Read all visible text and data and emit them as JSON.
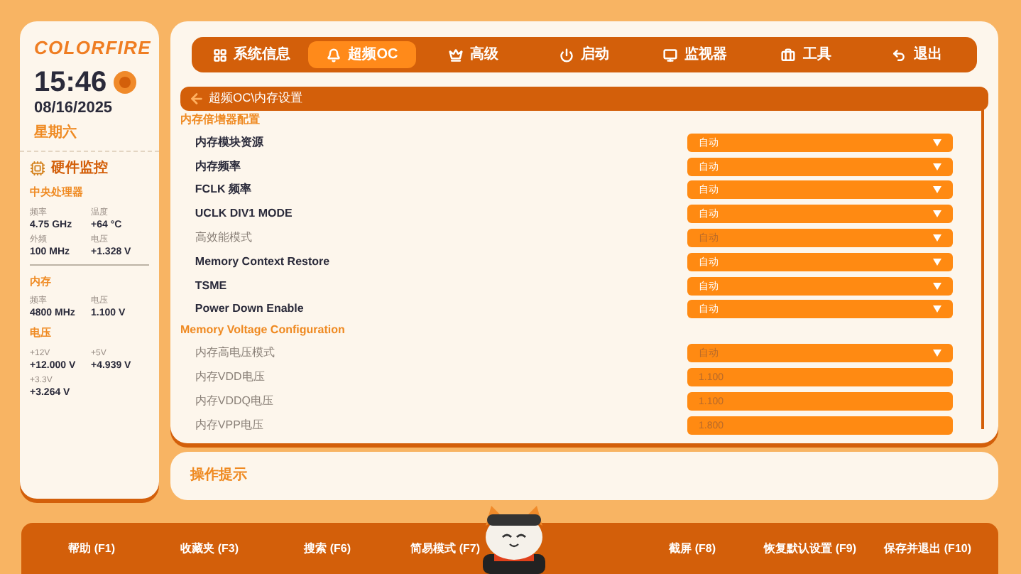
{
  "sidebar": {
    "brand": "COLORFIRE",
    "time": "15:46",
    "date": "08/16/2025",
    "weekday": "星期六",
    "monitor_title": "硬件监控",
    "groups": [
      {
        "title": "中央处理器",
        "stats": [
          {
            "label": "频率",
            "value": "4.75 GHz"
          },
          {
            "label": "温度",
            "value": "+64 °C"
          },
          {
            "label": "外频",
            "value": "100 MHz"
          },
          {
            "label": "电压",
            "value": "+1.328 V"
          }
        ]
      },
      {
        "title": "内存",
        "stats": [
          {
            "label": "频率",
            "value": "4800 MHz"
          },
          {
            "label": "电压",
            "value": "1.100 V"
          }
        ]
      },
      {
        "title": "电压",
        "stats": [
          {
            "label": "+12V",
            "value": "+12.000 V"
          },
          {
            "label": "+5V",
            "value": "+4.939 V"
          },
          {
            "label": "+3.3V",
            "value": "+3.264 V"
          }
        ]
      }
    ]
  },
  "tabs": [
    {
      "label": "系统信息",
      "selected": false
    },
    {
      "label": "超频OC",
      "selected": true
    },
    {
      "label": "高级",
      "selected": false
    },
    {
      "label": "启动",
      "selected": false
    },
    {
      "label": "监视器",
      "selected": false
    },
    {
      "label": "工具",
      "selected": false
    },
    {
      "label": "退出",
      "selected": false
    }
  ],
  "breadcrumb": "超频OC\\内存设置",
  "sections": [
    {
      "title": "内存倍增器配置",
      "rows": [
        {
          "label": "内存模块资源",
          "kind": "select",
          "value": "自动",
          "disabled": false
        },
        {
          "label": "内存频率",
          "kind": "select",
          "value": "自动",
          "disabled": false
        },
        {
          "label": "FCLK 频率",
          "kind": "select",
          "value": "自动",
          "disabled": false
        },
        {
          "label": "UCLK DIV1 MODE",
          "kind": "select",
          "value": "自动",
          "disabled": false
        },
        {
          "label": "高效能模式",
          "kind": "select",
          "value": "自动",
          "disabled": true
        },
        {
          "label": "Memory Context Restore",
          "kind": "select",
          "value": "自动",
          "disabled": false
        },
        {
          "label": "TSME",
          "kind": "select",
          "value": "自动",
          "disabled": false
        },
        {
          "label": "Power Down Enable",
          "kind": "select",
          "value": "自动",
          "disabled": false
        }
      ]
    },
    {
      "title": "Memory Voltage Configuration",
      "rows": [
        {
          "label": "内存高电压模式",
          "kind": "select",
          "value": "自动",
          "disabled": true
        },
        {
          "label": "内存VDD电压",
          "kind": "input",
          "value": "1.100",
          "disabled": true
        },
        {
          "label": "内存VDDQ电压",
          "kind": "input",
          "value": "1.100",
          "disabled": true
        },
        {
          "label": "内存VPP电压",
          "kind": "input",
          "value": "1.800",
          "disabled": true
        }
      ]
    }
  ],
  "hint_title": "操作提示",
  "footer": [
    {
      "label": "帮助 (F1)"
    },
    {
      "label": "收藏夹 (F3)"
    },
    {
      "label": "搜索 (F6)"
    },
    {
      "label": "简易模式 (F7)"
    },
    {
      "label": "截屏 (F8)"
    },
    {
      "label": "恢复默认设置 (F9)"
    },
    {
      "label": "保存并退出 (F10)"
    }
  ]
}
